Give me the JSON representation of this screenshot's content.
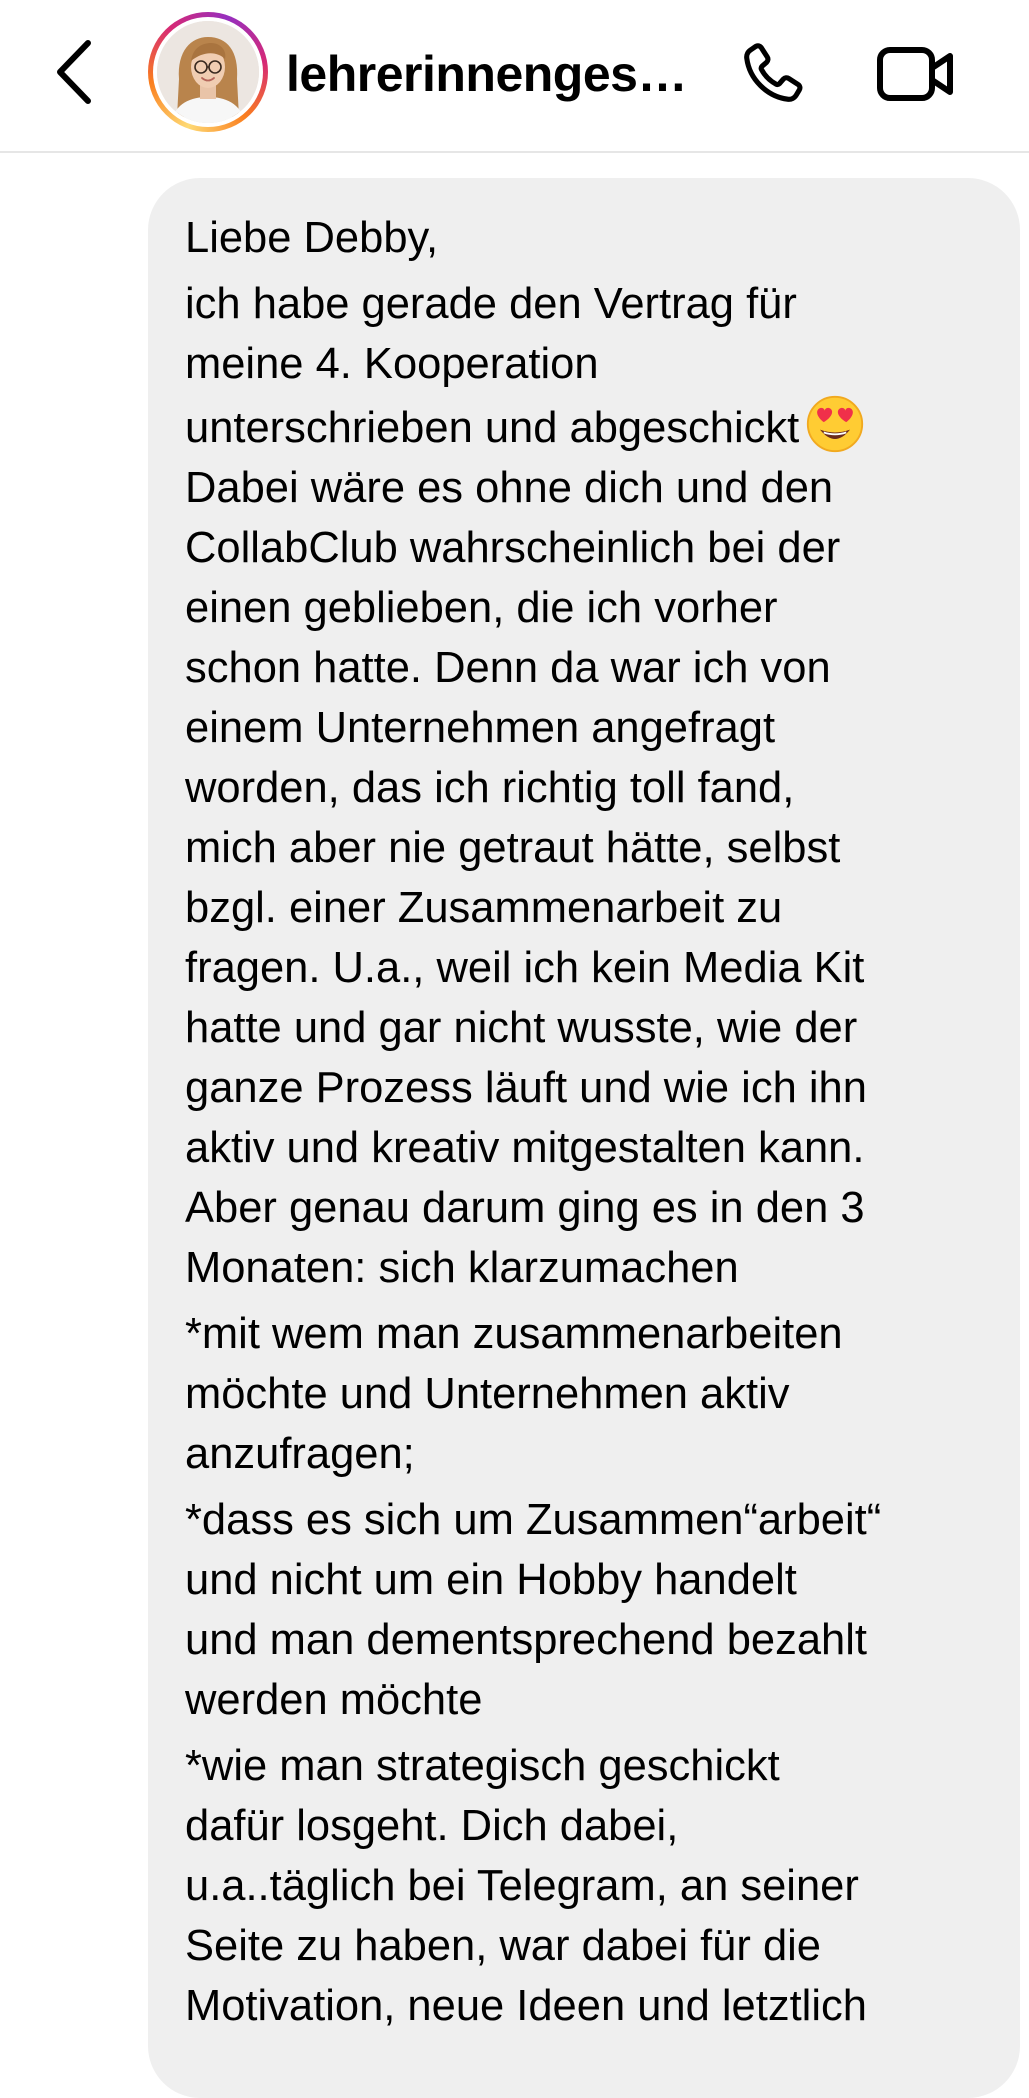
{
  "header": {
    "username": "lehrerinnenges…",
    "back_icon": "chevron-left-icon",
    "call_icon": "phone-icon",
    "video_icon": "video-camera-icon"
  },
  "message": {
    "lines": [
      "Liebe Debby,",
      "ich habe gerade den Vertrag für",
      "meine 4. Kooperation",
      "unterschrieben und abgeschickt",
      "Dabei wäre es ohne dich und den",
      "CollabClub wahrscheinlich bei der",
      "einen geblieben, die ich vorher",
      "schon hatte. Denn da war ich von",
      "einem Unternehmen angefragt",
      "worden, das ich richtig toll fand,",
      "mich aber nie getraut hätte, selbst",
      "bzgl. einer Zusammenarbeit zu",
      "fragen. U.a., weil ich kein Media Kit",
      "hatte und gar nicht wusste, wie der",
      "ganze Prozess läuft und wie ich ihn",
      "aktiv und kreativ mitgestalten kann.",
      "Aber genau darum ging es in den 3",
      "Monaten: sich klarzumachen",
      "*mit wem man zusammenarbeiten",
      "möchte und Unternehmen aktiv",
      "anzufragen;",
      "*dass es sich um Zusammen“arbeit“",
      "und nicht um ein Hobby handelt",
      "und man dementsprechend bezahlt",
      "werden möchte",
      "*wie man strategisch geschickt",
      "dafür losgeht. Dich dabei,",
      "u.a..täglich bei Telegram, an seiner",
      "Seite zu haben, war dabei für die",
      "Motivation, neue Ideen und letztlich"
    ],
    "emoji": "smiling-face-with-heart-eyes-icon"
  },
  "colors": {
    "bubble": "#efefef",
    "header_border": "#e6e6e6",
    "emoji_yellow": "#ffcc33",
    "emoji_heart": "#f0304a"
  }
}
